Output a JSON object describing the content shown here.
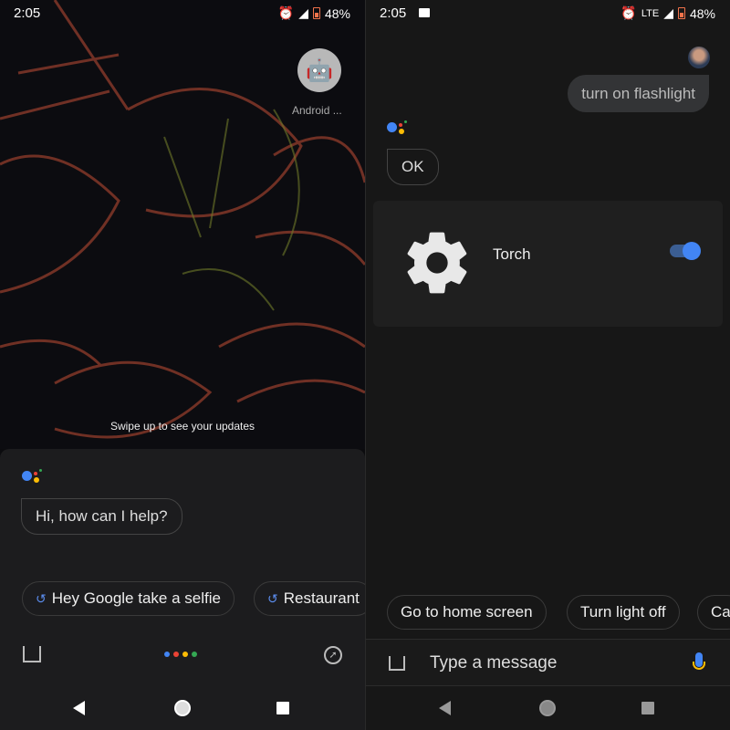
{
  "left": {
    "status": {
      "time": "2:05",
      "battery": "48%",
      "icons": [
        "alarm-icon",
        "signal-no-data-icon",
        "battery-icon"
      ]
    },
    "shortcut": {
      "label": "Android ...",
      "icon": "android-icon"
    },
    "swipe_hint": "Swipe up to see your updates",
    "assistant_greeting": "Hi, how can I help?",
    "suggestions": [
      {
        "label": "Hey Google take a selfie",
        "icon": "history-icon"
      },
      {
        "label": "Restaurant",
        "icon": "history-icon"
      }
    ],
    "bottom": {
      "left_icon": "updates-tray-icon",
      "center": "google-dots",
      "right_icon": "explore-compass-icon"
    }
  },
  "right": {
    "status": {
      "time": "2:05",
      "battery": "48%",
      "network": "LTE",
      "icons": [
        "gmail-icon",
        "alarm-icon",
        "signal-icon",
        "battery-icon"
      ]
    },
    "user_message": "turn on flashlight",
    "assistant_reply": "OK",
    "card": {
      "title": "Torch",
      "icon": "settings-gear-icon",
      "toggle_on": true
    },
    "suggestions": [
      "Go to home screen",
      "Turn light off",
      "Ca"
    ],
    "input": {
      "placeholder": "Type a message",
      "mic_icon": "mic-icon"
    }
  },
  "colors": {
    "blue": "#4285f4",
    "red": "#ea4335",
    "yellow": "#fbbc05",
    "green": "#34a853"
  }
}
